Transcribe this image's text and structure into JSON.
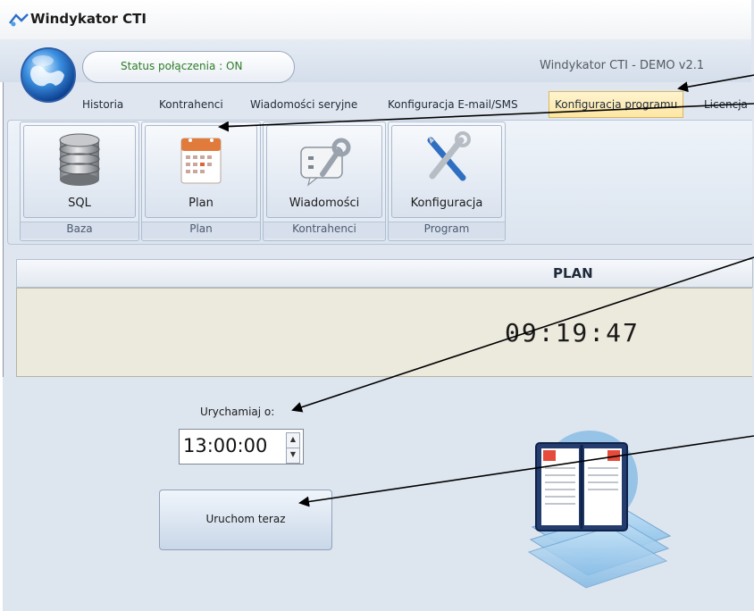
{
  "window": {
    "title": "Windykator CTI"
  },
  "status": {
    "connection": "Status połączenia : ON",
    "version": "Windykator CTI  - DEMO v2.1"
  },
  "tabs": [
    {
      "label": "Historia"
    },
    {
      "label": "Kontrahenci"
    },
    {
      "label": "Wiadomości seryjne"
    },
    {
      "label": "Konfiguracja E-mail/SMS"
    },
    {
      "label": "Konfiguracja programu",
      "active": true
    },
    {
      "label": "Licencja"
    }
  ],
  "ribbon": {
    "groups": [
      {
        "button": "SQL",
        "group": "Baza",
        "icon": "database-icon"
      },
      {
        "button": "Plan",
        "group": "Plan",
        "icon": "calendar-icon"
      },
      {
        "button": "Wiadomości",
        "group": "Kontrahenci",
        "icon": "message-wrench-icon"
      },
      {
        "button": "Konfiguracja",
        "group": "Program",
        "icon": "tools-icon"
      }
    ]
  },
  "plan": {
    "header": "PLAN",
    "clock": "09:19:47",
    "run_label": "Urychamiaj o:",
    "run_time": "13:00:00",
    "run_now_button": "Uruchom teraz"
  },
  "colors": {
    "status_on": "#2e7d27",
    "active_tab": "#fde7a4",
    "clock_panel": "#ece9dd"
  }
}
